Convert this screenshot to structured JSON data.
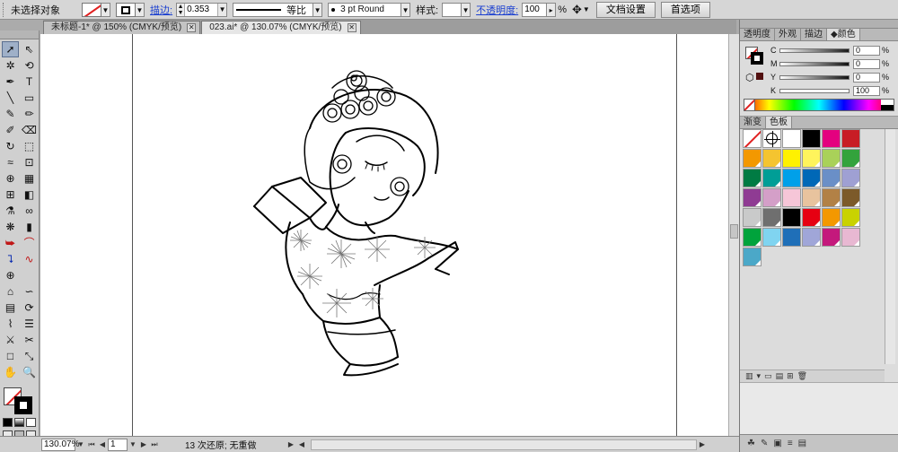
{
  "control_bar": {
    "selection_label": "未选择对象",
    "stroke_link": "描边:",
    "stroke_weight": "0.353",
    "stroke_profile": "等比",
    "brush": "3 pt Round",
    "style_label": "样式:",
    "opacity_link": "不透明度:",
    "opacity_value": "100",
    "opacity_unit": "%",
    "doc_setup_button": "文档设置",
    "prefs_button": "首选项"
  },
  "tabs": [
    {
      "label": "未标题-1* @ 150% (CMYK/预览)",
      "active": false
    },
    {
      "label": "023.ai* @ 130.07% (CMYK/预览)",
      "active": true
    }
  ],
  "toolbar": {
    "tools": [
      {
        "icon": "selection-tool-icon",
        "glyph": "➚",
        "selected": true
      },
      {
        "icon": "direct-selection-tool-icon",
        "glyph": "⇖"
      },
      {
        "icon": "magic-wand-tool-icon",
        "glyph": "✲"
      },
      {
        "icon": "lasso-tool-icon",
        "glyph": "⟲"
      },
      {
        "icon": "pen-tool-icon",
        "glyph": "✒"
      },
      {
        "icon": "type-tool-icon",
        "glyph": "T"
      },
      {
        "icon": "line-tool-icon",
        "glyph": "╲"
      },
      {
        "icon": "rectangle-tool-icon",
        "glyph": "▭"
      },
      {
        "icon": "paintbrush-tool-icon",
        "glyph": "✎"
      },
      {
        "icon": "pencil-tool-icon",
        "glyph": "✏"
      },
      {
        "icon": "blob-brush-tool-icon",
        "glyph": "✐"
      },
      {
        "icon": "eraser-tool-icon",
        "glyph": "⌫"
      },
      {
        "icon": "rotate-tool-icon",
        "glyph": "↻"
      },
      {
        "icon": "scale-tool-icon",
        "glyph": "⬚"
      },
      {
        "icon": "warp-tool-icon",
        "glyph": "≈"
      },
      {
        "icon": "free-transform-tool-icon",
        "glyph": "⊡"
      },
      {
        "icon": "shape-builder-tool-icon",
        "glyph": "⊕"
      },
      {
        "icon": "perspective-grid-tool-icon",
        "glyph": "▦"
      },
      {
        "icon": "mesh-tool-icon",
        "glyph": "⊞"
      },
      {
        "icon": "gradient-tool-icon",
        "glyph": "◧"
      },
      {
        "icon": "eyedropper-tool-icon",
        "glyph": "⚗"
      },
      {
        "icon": "blend-tool-icon",
        "glyph": "∞"
      },
      {
        "icon": "symbol-sprayer-tool-icon",
        "glyph": "❋"
      },
      {
        "icon": "column-graph-tool-icon",
        "glyph": "▮"
      },
      {
        "icon": "path-anchor-red-icon",
        "glyph": "⮩",
        "color": "red"
      },
      {
        "icon": "curve-red-icon",
        "glyph": "⌒",
        "color": "red"
      },
      {
        "icon": "path-anchor-blue-icon",
        "glyph": "⮧",
        "color": "blue"
      },
      {
        "icon": "curve-blue-red-icon",
        "glyph": "∿",
        "color": "red"
      },
      {
        "icon": "crosshair-tool-icon",
        "glyph": "⊕"
      },
      {
        "icon": "empty-slot-icon",
        "glyph": ""
      },
      {
        "icon": "envelope-distort-icon",
        "glyph": "⌂"
      },
      {
        "icon": "wave-distort-icon",
        "glyph": "∽"
      },
      {
        "icon": "grid-3d-icon",
        "glyph": "▤"
      },
      {
        "icon": "twirl-tool-icon",
        "glyph": "⟳"
      },
      {
        "icon": "zigzag-tool-icon",
        "glyph": "⌇"
      },
      {
        "icon": "align-tool-icon",
        "glyph": "☰"
      },
      {
        "icon": "slice-tool-icon",
        "glyph": "⚔"
      },
      {
        "icon": "scissors-tool-icon",
        "glyph": "✂"
      },
      {
        "icon": "artboard-tool-icon",
        "glyph": "□"
      },
      {
        "icon": "slice-select-tool-icon",
        "glyph": "⤡"
      },
      {
        "icon": "hand-tool-icon",
        "glyph": "✋"
      },
      {
        "icon": "zoom-tool-icon",
        "glyph": "🔍"
      }
    ]
  },
  "status_bar": {
    "zoom": "130.07%",
    "artboard_number": "1",
    "undo_info": "13 次还原; 无重做"
  },
  "color_panel": {
    "tabs": [
      "透明度",
      "外观",
      "描边",
      "颜色"
    ],
    "active_tab": "颜色",
    "channels": [
      {
        "label": "C",
        "value": "0"
      },
      {
        "label": "M",
        "value": "0"
      },
      {
        "label": "Y",
        "value": "0"
      },
      {
        "label": "K",
        "value": "100"
      }
    ],
    "unit": "%"
  },
  "swatches_panel": {
    "tabs": [
      "渐变",
      "色板"
    ],
    "active_tab": "色板",
    "colors": [
      "none",
      "registration",
      "#ffffff",
      "#000000",
      "#e4007f",
      "#c81d25",
      "#f39800",
      "#f4c430",
      "#fff100",
      "#fff45c",
      "#a9d159",
      "#33a33c",
      "#007b43",
      "#009e96",
      "#00a0e9",
      "#0068b7",
      "#6a8fc7",
      "#9fa0d3",
      "#8f3b93",
      "#d49fc8",
      "#f6c6d8",
      "#e8c39e",
      "#b28146",
      "#7c5a2a",
      "#c9caca",
      "#6f6f6f",
      "#000000",
      "#e60012",
      "#f39800",
      "#c9d200",
      "#00a33c",
      "#80d4f0",
      "#1f6fb8",
      "#a0a6d8",
      "#c4197c",
      "#e8b8d2",
      "#4ba8c8"
    ]
  }
}
